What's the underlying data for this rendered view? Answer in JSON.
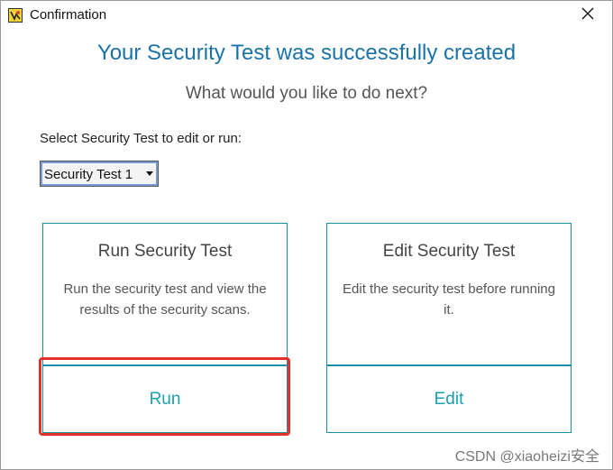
{
  "window": {
    "title": "Confirmation",
    "close_symbol": "✕"
  },
  "headline": "Your Security Test was successfully created",
  "subheadline": "What would you like to do next?",
  "selector": {
    "label": "Select Security Test to edit or run:",
    "selected_value": "Security Test 1"
  },
  "cards": {
    "run": {
      "title": "Run Security Test",
      "description": "Run the security test and view the results of the security scans.",
      "action_label": "Run"
    },
    "edit": {
      "title": "Edit Security Test",
      "description": "Edit the security test before running it.",
      "action_label": "Edit"
    }
  },
  "watermark": "CSDN @xiaoheizi安全",
  "colors": {
    "accent": "#1a73a8",
    "card_border": "#1a8fa8",
    "action_text": "#1a9fb0",
    "highlight": "#e5302a"
  },
  "icons": {
    "app": "app-icon",
    "close": "close-icon",
    "dropdown": "chevron-down-icon"
  }
}
